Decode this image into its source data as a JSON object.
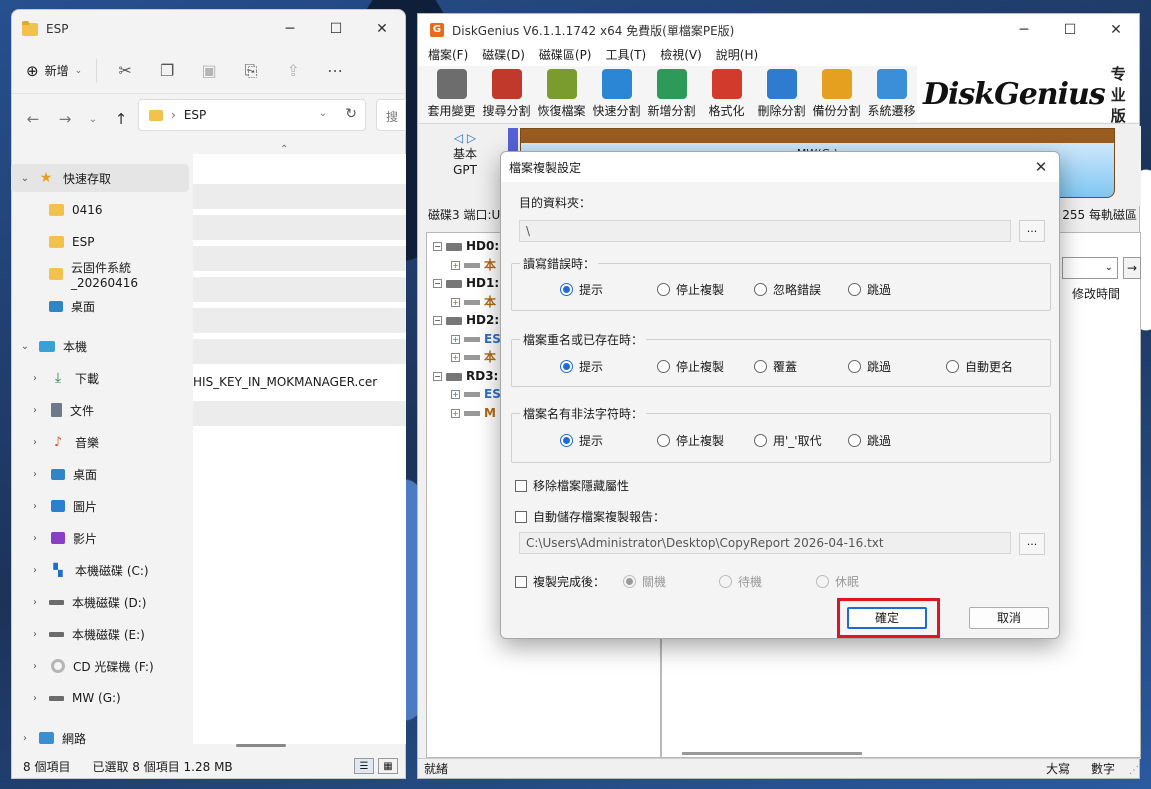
{
  "explorer": {
    "title": "ESP",
    "new_label": "新增",
    "address_path": "ESP",
    "search_stub": "搜",
    "nav": {
      "quick_access": "快速存取",
      "items": [
        "0416",
        "ESP",
        "云固件系統_20260416",
        "桌面"
      ],
      "this_pc": "本機",
      "pc_items": [
        "下載",
        "文件",
        "音樂",
        "桌面",
        "圖片",
        "影片",
        "本機磁碟 (C:)",
        "本機磁碟 (D:)",
        "本機磁碟 (E:)",
        "CD 光碟機 (F:)",
        "MW (G:)"
      ],
      "network": "網路"
    },
    "visible_file": "HIS_KEY_IN_MOKMANAGER.cer",
    "status": {
      "count": "8 個項目",
      "selected": "已選取 8 個項目  1.28 MB"
    }
  },
  "diskgenius": {
    "title": "DiskGenius V6.1.1.1742 x64 免費版(單檔案PE版)",
    "menu": [
      "檔案(F)",
      "磁碟(D)",
      "磁碟區(P)",
      "工具(T)",
      "檢視(V)",
      "說明(H)"
    ],
    "tools": [
      {
        "label": "套用變更",
        "color": "#6d6d6d"
      },
      {
        "label": "搜尋分割",
        "color": "#c0392b"
      },
      {
        "label": "恢復檔案",
        "color": "#7a9b2e"
      },
      {
        "label": "快速分割",
        "color": "#2b86d6"
      },
      {
        "label": "新增分割",
        "color": "#2e9a5a"
      },
      {
        "label": "格式化",
        "color": "#d23b2b"
      },
      {
        "label": "刪除分割",
        "color": "#2f7bd0"
      },
      {
        "label": "備份分割",
        "color": "#e6a020"
      },
      {
        "label": "系統遷移",
        "color": "#3b8fd8"
      }
    ],
    "brand": "DiskGenius",
    "brand_edition": "专业版",
    "basic": "基本",
    "gpt": "GPT",
    "partition_label": "MW(G:)",
    "disk_info_left": "磁碟3 端口:U",
    "disk_info_right": "255 每軌磁區",
    "tree": [
      {
        "label": "HD0:",
        "type": "disk"
      },
      {
        "label": "本",
        "type": "child"
      },
      {
        "label": "HD1:",
        "type": "disk"
      },
      {
        "label": "本",
        "type": "child"
      },
      {
        "label": "HD2:",
        "type": "disk"
      },
      {
        "label": "ES",
        "type": "child-blue"
      },
      {
        "label": "本",
        "type": "child"
      },
      {
        "label": "RD3:",
        "type": "disk"
      },
      {
        "label": "ES",
        "type": "child-blue"
      },
      {
        "label": "M",
        "type": "child"
      }
    ],
    "modified_time": "修改時間",
    "status_ready": "就緒",
    "status_caps": "大寫",
    "status_num": "數字"
  },
  "dialog": {
    "title": "檔案複製設定",
    "dest_label": "目的資料夾：",
    "dest_value": "\\",
    "browse": "...",
    "group1": {
      "title": "讀寫錯誤時：",
      "options": [
        "提示",
        "停止複製",
        "忽略錯誤",
        "跳過"
      ]
    },
    "group2": {
      "title": "檔案重名或已存在時：",
      "options": [
        "提示",
        "停止複製",
        "覆蓋",
        "跳過",
        "自動更名"
      ]
    },
    "group3": {
      "title": "檔案名有非法字符時：",
      "options": [
        "提示",
        "停止複製",
        "用'_'取代",
        "跳過"
      ]
    },
    "remove_hidden": "移除檔案隱藏屬性",
    "auto_save_report": "自動儲存檔案複製報告：",
    "report_path": "C:\\Users\\Administrator\\Desktop\\CopyReport 2026-04-16.txt",
    "after_copy": "複製完成後：",
    "after_options": [
      "關機",
      "待機",
      "休眠"
    ],
    "ok": "確定",
    "cancel": "取消"
  }
}
